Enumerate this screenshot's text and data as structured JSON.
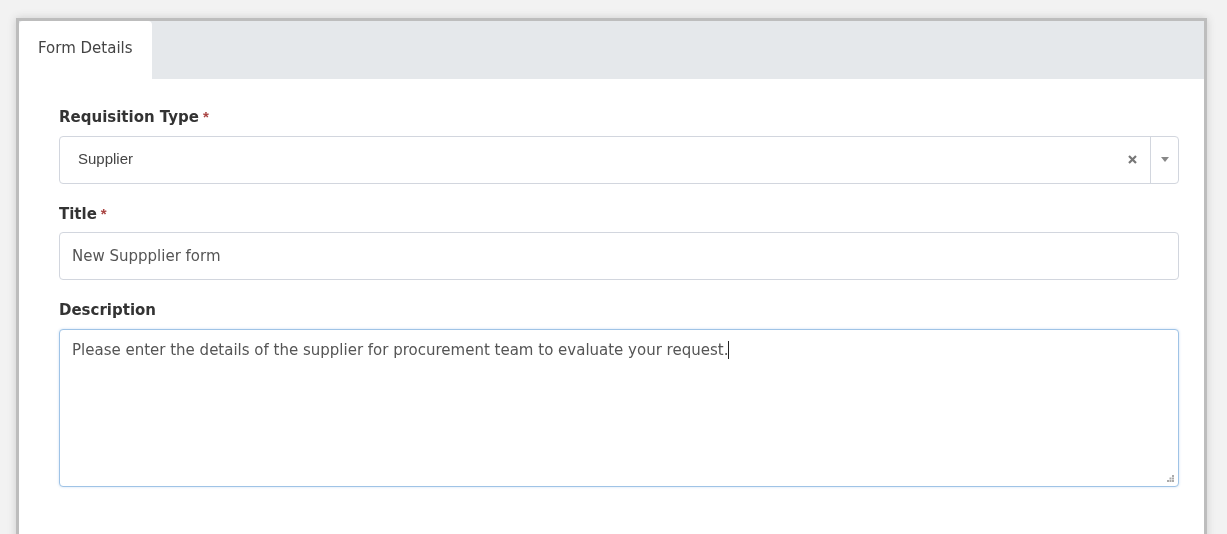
{
  "tabs": [
    {
      "label": "Form Details",
      "selected": true
    }
  ],
  "fields": [
    {
      "kind": "select",
      "label": "Requisition Type",
      "marker": "*",
      "value": "Supplier",
      "clearable": true
    },
    {
      "kind": "input",
      "label": "Title",
      "marker": "*",
      "value": "New Suppplier form"
    },
    {
      "kind": "textarea",
      "label": "Description",
      "value": "Please enter the details of the supplier for procurement team to evaluate your request.",
      "focused": true
    }
  ]
}
